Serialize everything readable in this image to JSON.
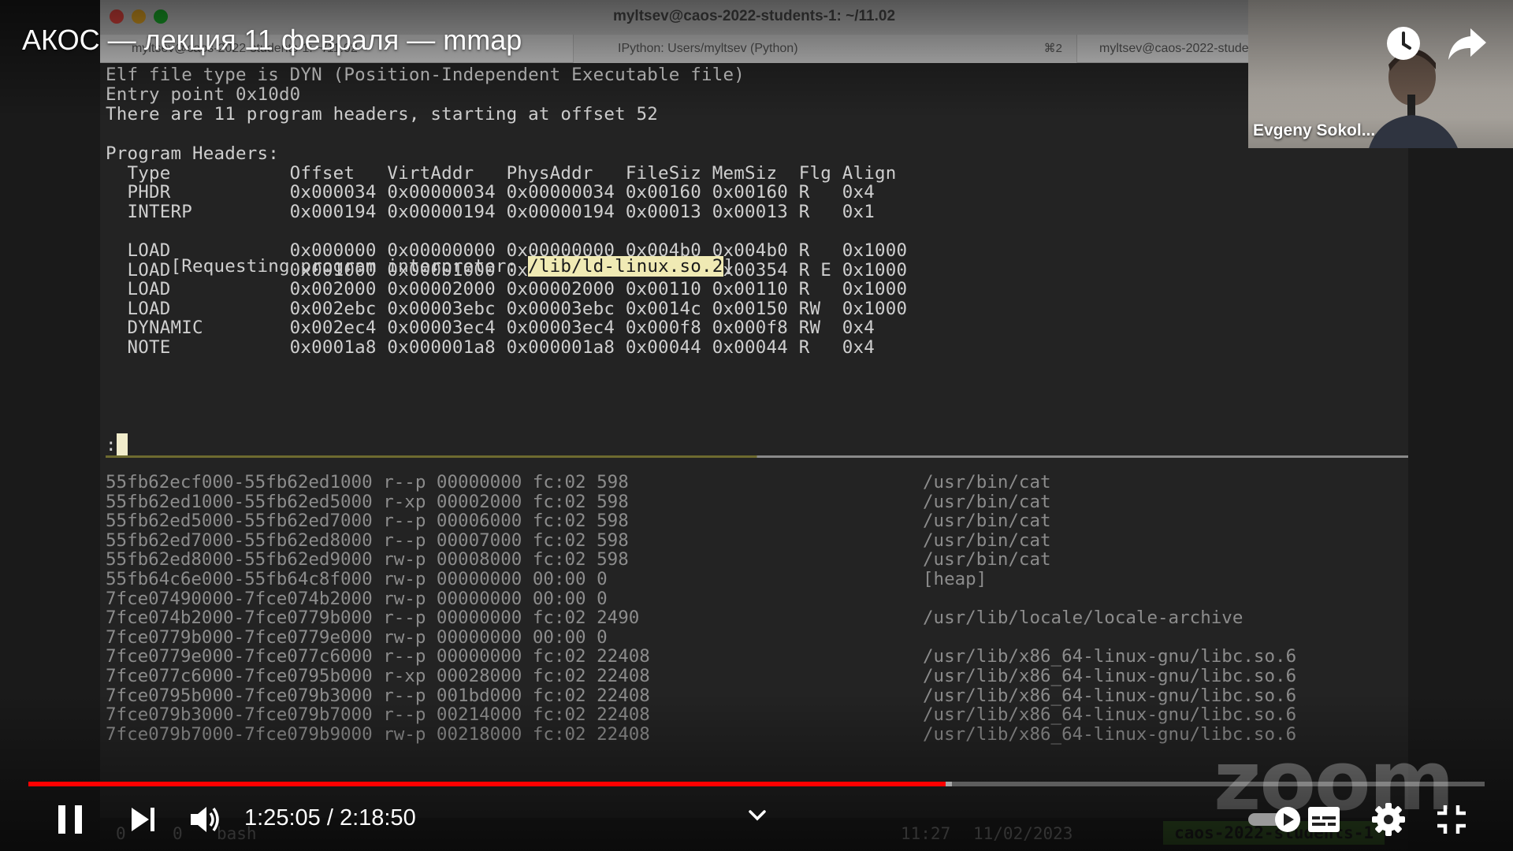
{
  "overlay": {
    "video_title": "АКОС — лекция 11 февраля — mmap",
    "time_current": "1:25:05",
    "time_separator": " / ",
    "time_total": "2:18:50",
    "progress_played_fraction": 0.63,
    "progress_loaded_fraction": 0.634,
    "icons": [
      "watch-later-icon",
      "share-icon",
      "pause-icon",
      "next-icon",
      "volume-icon",
      "chevron-down-icon",
      "autoplay-icon",
      "subtitles-icon",
      "settings-icon",
      "exit-fullscreen-icon"
    ],
    "accent_color": "#ff0000"
  },
  "window": {
    "title": "myltsev@caos-2022-students-1: ~/11.02",
    "tabs": [
      {
        "label": "myltsev@caos-2022-students-1: ~/11.02"
      },
      {
        "label": "IPython: Users/myltsev (Python)",
        "shortcut": "⌘2"
      },
      {
        "label": "myltsev@caos-2022-students-1: ~/11.02"
      }
    ]
  },
  "terminal": {
    "readelf_lines": [
      "Elf file type is DYN (Position-Independent Executable file)",
      "Entry point 0x10d0",
      "There are 11 program headers, starting at offset 52",
      "",
      "Program Headers:",
      "  Type           Offset   VirtAddr   PhysAddr   FileSiz MemSiz  Flg Align",
      "  PHDR           0x000034 0x00000034 0x00000034 0x00160 0x00160 R   0x4",
      "  INTERP         0x000194 0x00000194 0x00000194 0x00013 0x00013 R   0x1",
      "  LOAD           0x000000 0x00000000 0x00000000 0x004b0 0x004b0 R   0x1000",
      "  LOAD           0x001000 0x00001000 0x00001000 0x00354 0x00354 R E 0x1000",
      "  LOAD           0x002000 0x00002000 0x00002000 0x00110 0x00110 R   0x1000",
      "  LOAD           0x002ebc 0x00003ebc 0x00003ebc 0x0014c 0x00150 RW  0x1000",
      "  DYNAMIC        0x002ec4 0x00003ec4 0x00003ec4 0x000f8 0x000f8 RW  0x4",
      "  NOTE           0x0001a8 0x000001a8 0x000001a8 0x00044 0x00044 R   0x4"
    ],
    "interp_prefix": "      [Requesting program interpreter: ",
    "interp_path": "/lib/ld-linux.so.2",
    "interp_suffix": "]",
    "pager_prompt": ":",
    "maps": [
      {
        "range": "55fb62ecf000-55fb62ed1000 r--p 00000000 fc:02 598",
        "path": "/usr/bin/cat"
      },
      {
        "range": "55fb62ed1000-55fb62ed5000 r-xp 00002000 fc:02 598",
        "path": "/usr/bin/cat"
      },
      {
        "range": "55fb62ed5000-55fb62ed7000 r--p 00006000 fc:02 598",
        "path": "/usr/bin/cat"
      },
      {
        "range": "55fb62ed7000-55fb62ed8000 r--p 00007000 fc:02 598",
        "path": "/usr/bin/cat"
      },
      {
        "range": "55fb62ed8000-55fb62ed9000 rw-p 00008000 fc:02 598",
        "path": "/usr/bin/cat"
      },
      {
        "range": "55fb64c6e000-55fb64c8f000 rw-p 00000000 00:00 0",
        "path": "[heap]"
      },
      {
        "range": "7fce07490000-7fce074b2000 rw-p 00000000 00:00 0",
        "path": ""
      },
      {
        "range": "7fce074b2000-7fce0779b000 r--p 00000000 fc:02 2490",
        "path": "/usr/lib/locale/locale-archive"
      },
      {
        "range": "7fce0779b000-7fce0779e000 rw-p 00000000 00:00 0",
        "path": ""
      },
      {
        "range": "7fce0779e000-7fce077c6000 r--p 00000000 fc:02 22408",
        "path": "/usr/lib/x86_64-linux-gnu/libc.so.6"
      },
      {
        "range": "7fce077c6000-7fce0795b000 r-xp 00028000 fc:02 22408",
        "path": "/usr/lib/x86_64-linux-gnu/libc.so.6"
      },
      {
        "range": "7fce0795b000-7fce079b3000 r--p 001bd000 fc:02 22408",
        "path": "/usr/lib/x86_64-linux-gnu/libc.so.6"
      },
      {
        "range": "7fce079b3000-7fce079b7000 r--p 00214000 fc:02 22408",
        "path": "/usr/lib/x86_64-linux-gnu/libc.so.6"
      },
      {
        "range": "7fce079b7000-7fce079b9000 rw-p 00218000 fc:02 22408",
        "path": "/usr/lib/x86_64-linux-gnu/libc.so.6"
      }
    ],
    "tmux": {
      "window_index": "0",
      "pane": "0",
      "program": "bash",
      "clock": "11:27",
      "date": "11/02/2023",
      "host": "caos-2022-students-1"
    }
  },
  "camera": {
    "participant_name": "Evgeny Sokol..."
  },
  "watermark": {
    "text": "zoom"
  }
}
